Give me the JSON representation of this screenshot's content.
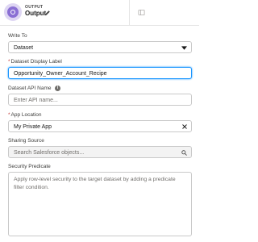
{
  "header": {
    "node_type": "OUTPUT",
    "node_name": "Output",
    "node_icon": "output-node-icon",
    "edit_icon": "pencil-icon",
    "collapse_icon": "collapse-panel-icon"
  },
  "form": {
    "write_to": {
      "label": "Write To",
      "value": "Dataset",
      "icon": "chevron-down-icon"
    },
    "dataset_display_label": {
      "required_mark": "*",
      "label": "Dataset Display Label",
      "value": "Opportunity_Owner_Account_Recipe"
    },
    "dataset_api_name": {
      "label": "Dataset API Name",
      "info_glyph": "i",
      "placeholder": "Enter API name..."
    },
    "app_location": {
      "required_mark": "*",
      "label": "App Location",
      "value": "My Private App",
      "icon": "clear-icon"
    },
    "sharing_source": {
      "label": "Sharing Source",
      "placeholder": "Search Salesforce objects...",
      "icon": "search-icon"
    },
    "security_predicate": {
      "label": "Security Predicate",
      "placeholder": "Apply row-level security to the target dataset by adding a predicate filter condition."
    }
  },
  "colors": {
    "accent": "#8a6fd4",
    "focus": "#1b96ff",
    "required": "#c23934"
  }
}
